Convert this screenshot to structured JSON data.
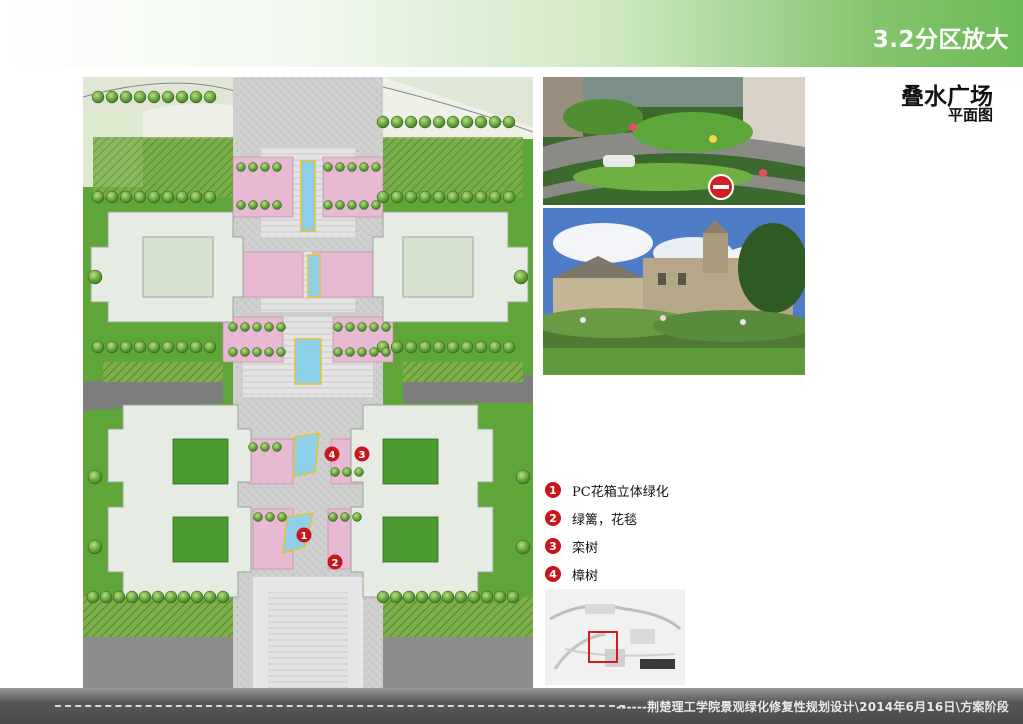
{
  "header": {
    "section_title": "3.2分区放大"
  },
  "titles": {
    "plaza_title": "叠水广场",
    "plan_subtitle": "平面图"
  },
  "legend": {
    "items": [
      {
        "number": "1",
        "label": "PC花箱立体绿化"
      },
      {
        "number": "2",
        "label": "绿篱，花毯"
      },
      {
        "number": "3",
        "label": "栾树"
      },
      {
        "number": "4",
        "label": "樟树"
      }
    ]
  },
  "plan_markers": [
    "1",
    "2",
    "3",
    "4"
  ],
  "footer": {
    "text": "------荆楚理工学院景观绿化修复性规划设计\\2014年6月16日\\方案阶段"
  },
  "colors": {
    "accent_green": "#6cb956",
    "marker_red": "#c8161d",
    "lawn_green": "#5fa638",
    "building_white": "#e6ece4",
    "pink_planter": "#e7b9d2",
    "water_blue": "#8ed0ea"
  }
}
